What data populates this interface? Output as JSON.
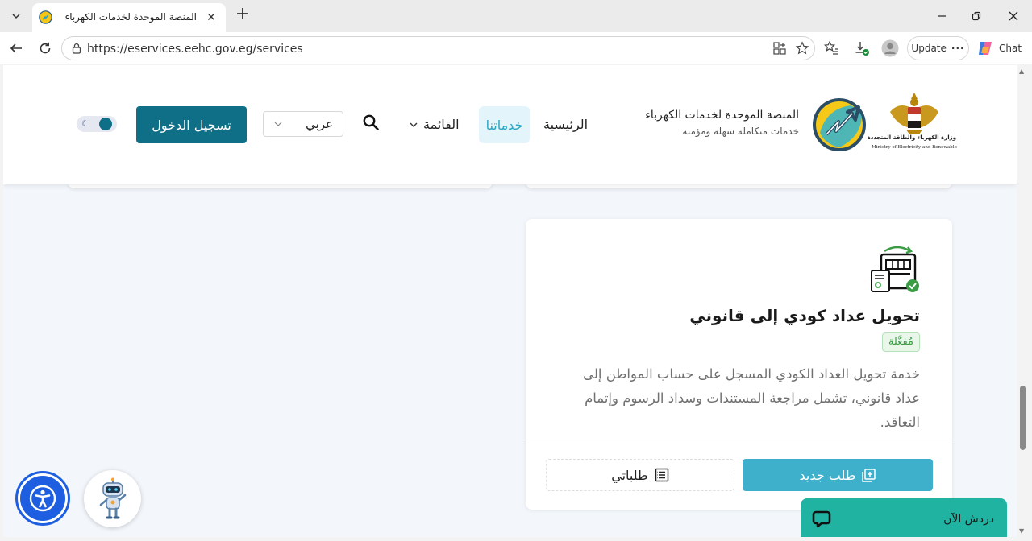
{
  "browser": {
    "tab_title": "المنصة الموحدة لخدمات الكهرباء",
    "url": "https://eservices.eehc.gov.eg/services",
    "update_label": "Update",
    "chat_label": "Chat"
  },
  "header": {
    "ministry_ar": "وزارة الكهرباء والطاقة المتجددة",
    "ministry_en": "Ministry of Electricity and Renewable",
    "brand_title": "المنصة الموحدة لخدمات الكهرباء",
    "brand_subtitle": "خدمات متكاملة سهلة ومؤمنة",
    "nav": {
      "home": "الرئيسية",
      "services": "خدماتنا",
      "menu": "القائمة"
    },
    "language": "عربي",
    "login_label": "تسجيل الدخول"
  },
  "service_card": {
    "title": "تحويل عداد كودي إلى قانوني",
    "status": "مُفعَّلة",
    "description": "خدمة تحويل العداد الكودي المسجل على حساب المواطن إلى عداد قانوني، تشمل مراجعة المستندات وسداد الرسوم وإتمام التعاقد.",
    "new_request_label": "طلب جديد",
    "my_requests_label": "طلباتي"
  },
  "widgets": {
    "chat_now_label": "دردش الآن"
  },
  "colors": {
    "primary": "#0f6f86",
    "accent": "#3fb0cc",
    "services_active_bg": "#e3f4fb",
    "badge_green": "#3a9c44",
    "chat_widget": "#20b3a2",
    "accessibility_blue": "#1d5fe0"
  },
  "icons": {
    "accessibility": "accessibility-icon",
    "chatbot": "robot-icon",
    "chat": "chat-bubble-icon",
    "search": "search-icon",
    "theme": "moon-icon"
  }
}
